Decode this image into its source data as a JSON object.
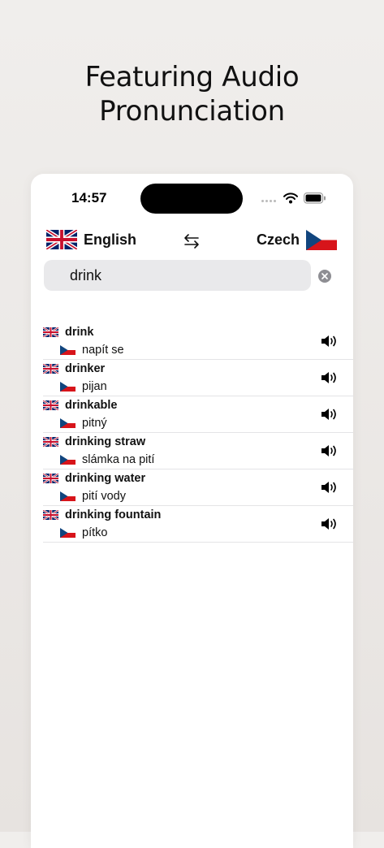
{
  "headline": {
    "line1": "Featuring Audio",
    "line2": "Pronunciation"
  },
  "status_bar": {
    "time": "14:57",
    "icons": [
      "cellular-signal-icon",
      "wifi-icon",
      "battery-icon"
    ]
  },
  "language_bar": {
    "source_language": "English",
    "source_flag": "uk-flag-icon",
    "swap_icon": "swap-arrows-icon",
    "target_language": "Czech",
    "target_flag": "czech-flag-icon"
  },
  "search": {
    "value": "drink",
    "clear_icon": "clear-circle-icon"
  },
  "results": [
    {
      "term": "drink",
      "translation": "napít se"
    },
    {
      "term": "drinker",
      "translation": "pijan"
    },
    {
      "term": "drinkable",
      "translation": "pitný"
    },
    {
      "term": "drinking straw",
      "translation": "slámka na pití"
    },
    {
      "term": "drinking water",
      "translation": "pití vody"
    },
    {
      "term": "drinking fountain",
      "translation": "pítko"
    }
  ],
  "colors": {
    "uk_blue": "#012169",
    "uk_red": "#C8102E",
    "cz_blue": "#11457E",
    "cz_red": "#D7141A",
    "search_bg": "#E9E9EB"
  }
}
